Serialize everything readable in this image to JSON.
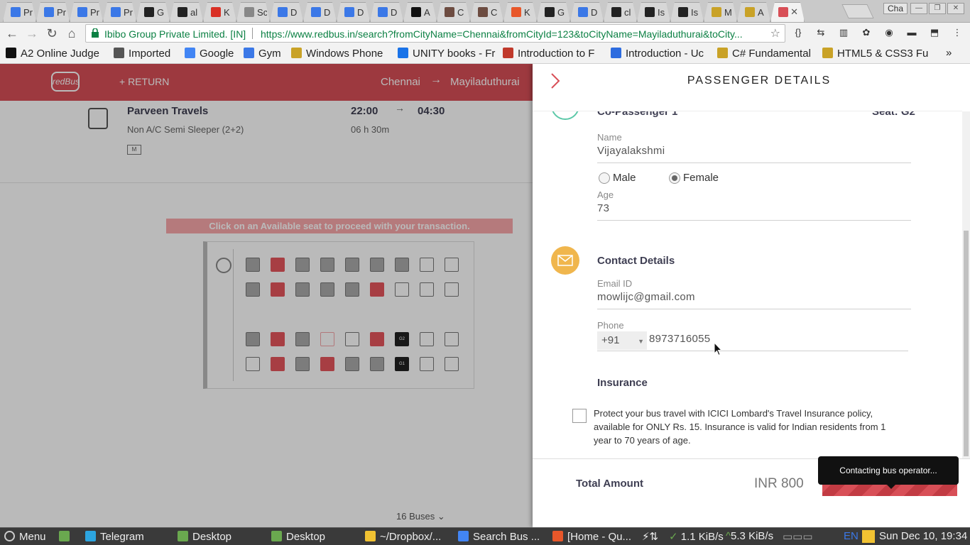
{
  "browser": {
    "tabs": [
      {
        "title": "Pr",
        "color": "#3b78e7"
      },
      {
        "title": "Pr",
        "color": "#3b78e7"
      },
      {
        "title": "Pr",
        "color": "#3b78e7"
      },
      {
        "title": "Pr",
        "color": "#3b78e7"
      },
      {
        "title": "G",
        "color": "#222222"
      },
      {
        "title": "al",
        "color": "#222222"
      },
      {
        "title": "K",
        "color": "#d93025"
      },
      {
        "title": "Sc",
        "color": "#888888"
      },
      {
        "title": "D",
        "color": "#3b78e7"
      },
      {
        "title": "D",
        "color": "#3b78e7"
      },
      {
        "title": "D",
        "color": "#3b78e7"
      },
      {
        "title": "D",
        "color": "#3b78e7"
      },
      {
        "title": "A",
        "color": "#111111"
      },
      {
        "title": "C",
        "color": "#6d4c41"
      },
      {
        "title": "C",
        "color": "#6d4c41"
      },
      {
        "title": "K",
        "color": "#e8572a"
      },
      {
        "title": "G",
        "color": "#222222"
      },
      {
        "title": "D",
        "color": "#3b78e7"
      },
      {
        "title": "cl",
        "color": "#222222"
      },
      {
        "title": "Is",
        "color": "#222222"
      },
      {
        "title": "Is",
        "color": "#222222"
      },
      {
        "title": "M",
        "color": "#c9a227"
      },
      {
        "title": "A",
        "color": "#c9a227"
      }
    ],
    "active_tab_close": "✕",
    "profile": "Cha",
    "window_controls": {
      "minimize": "—",
      "maximize": "❐",
      "close": "✕"
    },
    "nav": {
      "back": "←",
      "forward": "→",
      "reload": "↻",
      "home": "⌂"
    },
    "site_identity": "Ibibo Group Private Limited. [IN]",
    "url": "https://www.redbus.in/search?fromCityName=Chennai&fromCityId=123&toCityName=Mayiladuthurai&toCity...",
    "star": "☆",
    "extensions": [
      "{}",
      "⇆",
      "▥",
      "✿",
      "◉",
      "▬",
      "⬒",
      "⋮"
    ],
    "bookmarks": [
      {
        "label": "A2 Online Judge",
        "color": "#111111"
      },
      {
        "label": "Imported",
        "color": "#555555"
      },
      {
        "label": "Google",
        "color": "#4285f4"
      },
      {
        "label": "Gym",
        "color": "#3b78e7"
      },
      {
        "label": "Windows Phone",
        "color": "#c9a227"
      },
      {
        "label": "UNITY books - Fr",
        "color": "#1a73e8"
      },
      {
        "label": "Introduction to F",
        "color": "#c0392b"
      },
      {
        "label": "Introduction - Uc",
        "color": "#2d6cdf"
      },
      {
        "label": "C# Fundamental",
        "color": "#c9a227"
      },
      {
        "label": "HTML5 & CSS3 Fu",
        "color": "#c9a227"
      }
    ],
    "bookmarks_more": "»"
  },
  "redbus": {
    "header": {
      "logo": "redBus",
      "return": "+ RETURN",
      "from": "Chennai",
      "arrow": "→",
      "to": "Mayiladuthurai"
    },
    "bus": {
      "operator": "Parveen Travels",
      "type": "Non A/C Semi Sleeper (2+2)",
      "departure": "22:00",
      "arrival": "04:30",
      "duration": "06 h 30m",
      "mticket": "M"
    },
    "banner": "Click on an Available seat to proceed with your transaction.",
    "seats": {
      "selected_1": "G2",
      "selected_2": "G1"
    },
    "buses_count": "16 Buses",
    "buses_caret": "⌄"
  },
  "panel": {
    "title": "PASSENGER DETAILS",
    "copassenger": {
      "title": "Co-Passenger 1",
      "seat": "Seat: G2",
      "name_label": "Name",
      "name_value": "Vijayalakshmi",
      "gender_male": "Male",
      "gender_female": "Female",
      "gender_selected": "Female",
      "age_label": "Age",
      "age_value": "73"
    },
    "contact": {
      "title": "Contact Details",
      "email_label": "Email ID",
      "email_value": "mowlijc@gmail.com",
      "phone_label": "Phone",
      "country_code": "+91",
      "phone_value": "8973716055"
    },
    "insurance": {
      "title": "Insurance",
      "text": "Protect your bus travel with ICICI Lombard's Travel Insurance policy, available for ONLY Rs. 15. Insurance is valid for Indian residents from 1 year to 70 years of age.",
      "checked": false
    },
    "footer": {
      "total_label": "Total Amount",
      "total_amount": "INR 800",
      "tooltip": "Contacting bus operator..."
    }
  },
  "taskbar": {
    "menu": "Menu",
    "items": [
      {
        "label": "Telegram",
        "color": "#2ca5e0"
      },
      {
        "label": "Desktop",
        "color": "#6aa84f"
      },
      {
        "label": "Desktop",
        "color": "#6aa84f"
      },
      {
        "label": "~/Dropbox/...",
        "color": "#f1c232"
      },
      {
        "label": "Search Bus ...",
        "color": "#4285f4"
      },
      {
        "label": "[Home - Qu...",
        "color": "#e8572a"
      }
    ],
    "net_down": "1.1 KiB/s",
    "net_up": "5.3 KiB/s",
    "lang": "EN",
    "clock": "Sun Dec 10, 19:34"
  }
}
